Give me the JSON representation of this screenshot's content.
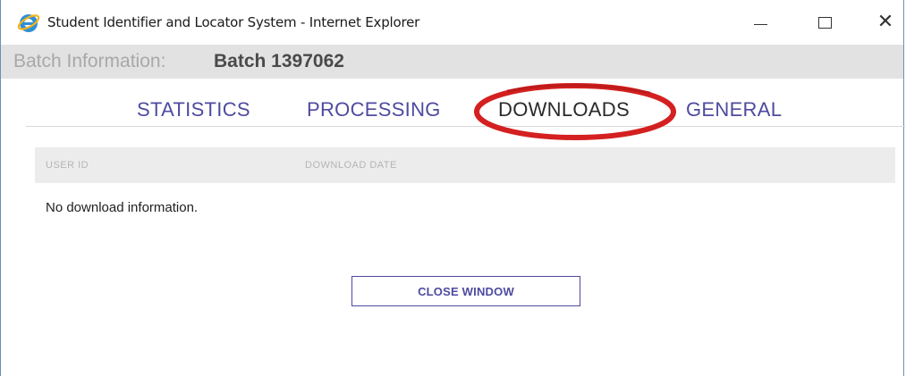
{
  "window": {
    "title": "Student Identifier and Locator System - Internet Explorer",
    "icon": "internet-explorer-icon",
    "close_glyph": "✕"
  },
  "batch": {
    "label": "Batch Information:",
    "value": "Batch 1397062"
  },
  "tabs": [
    {
      "label": "STATISTICS",
      "active": false
    },
    {
      "label": "PROCESSING",
      "active": false
    },
    {
      "label": "DOWNLOADS",
      "active": true
    },
    {
      "label": "GENERAL",
      "active": false
    }
  ],
  "table": {
    "columns": [
      "USER ID",
      "DOWNLOAD DATE"
    ],
    "empty_message": "No download information."
  },
  "close_button": {
    "label": "CLOSE WINDOW"
  },
  "colors": {
    "tab_text": "#4e4aa0",
    "highlight_ring": "#d42020",
    "header_band": "#e2e2e2"
  }
}
